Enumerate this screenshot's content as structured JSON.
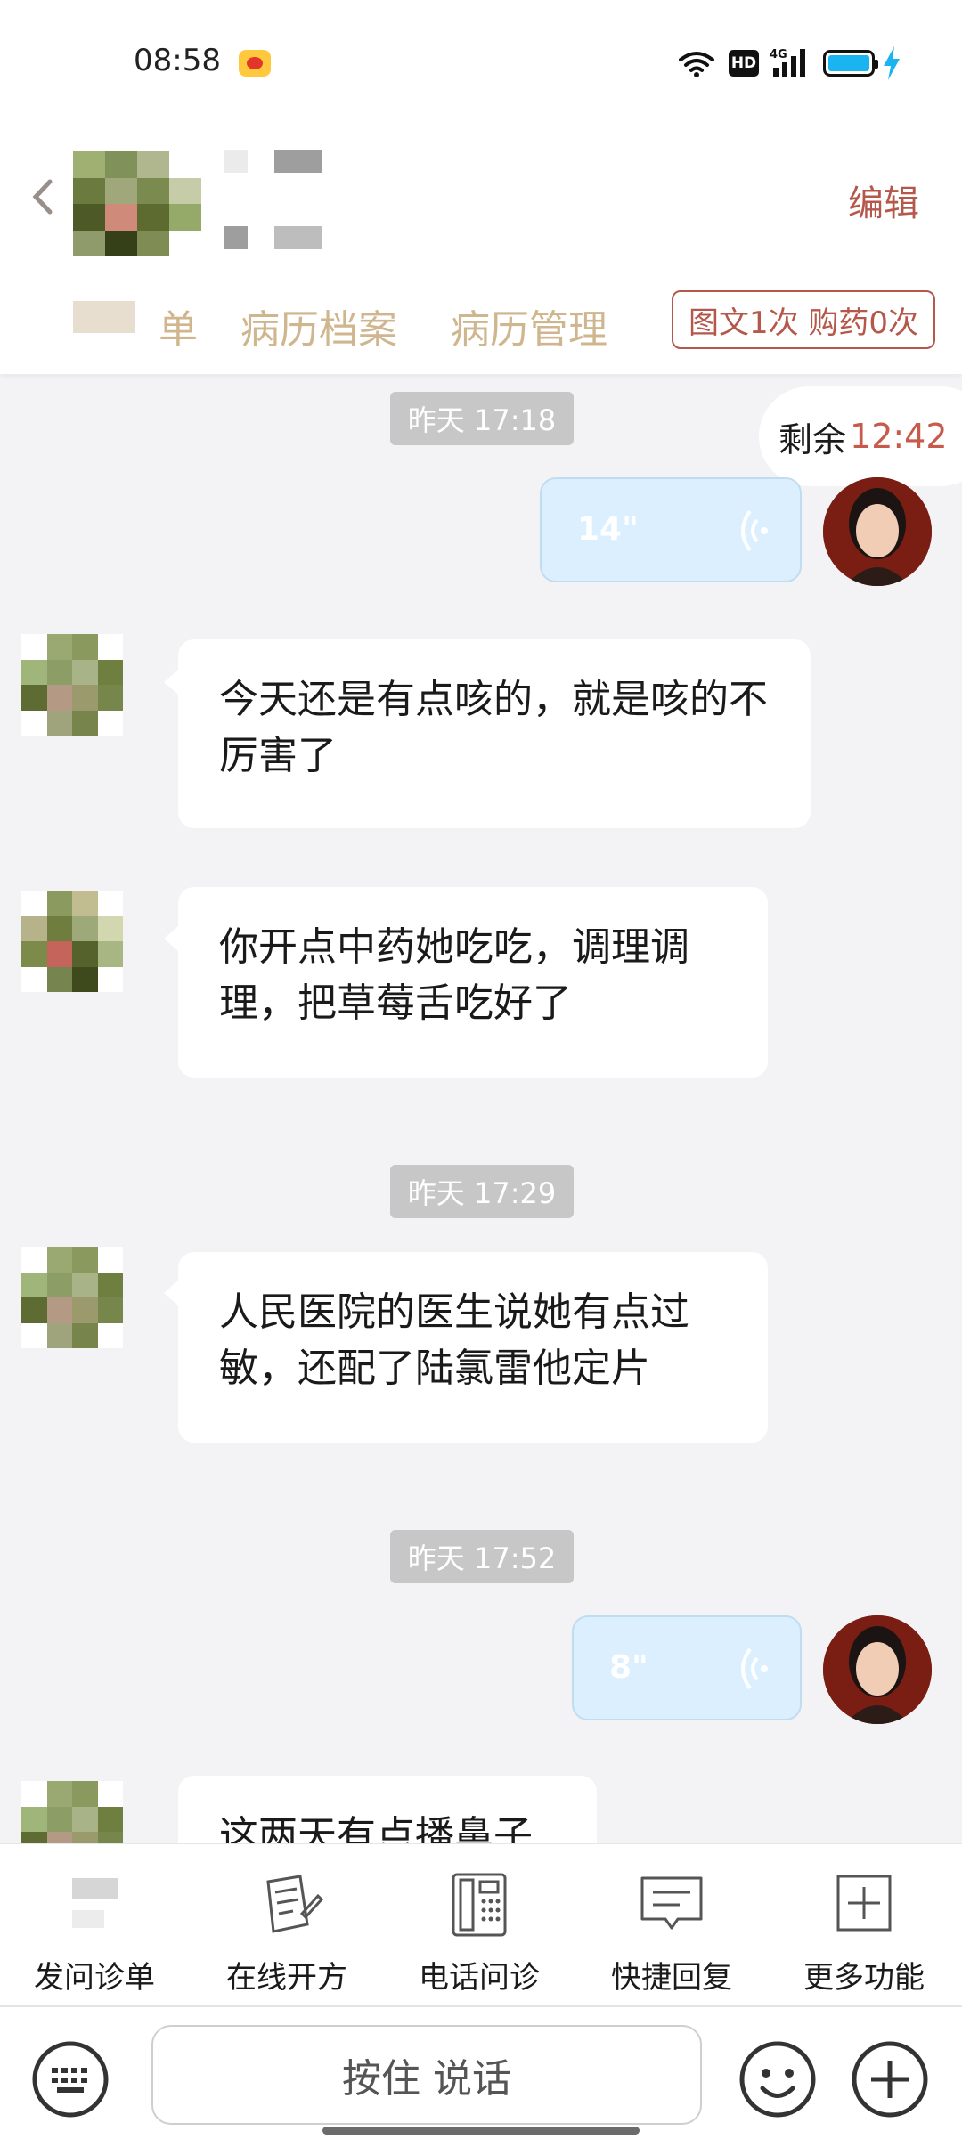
{
  "status_bar": {
    "time": "08:58",
    "network": "4G",
    "hd_label": "HD",
    "icons": [
      "weibo-icon",
      "wifi-icon",
      "signal-icon",
      "battery-icon",
      "charging-icon"
    ]
  },
  "header": {
    "edit_label": "编辑",
    "tabs": [
      "单",
      "病历档案",
      "病历管理"
    ],
    "quota_label": "图文1次 购药0次"
  },
  "remaining": {
    "label": "剩余",
    "time": "12:42"
  },
  "messages": [
    {
      "type": "timestamp",
      "text": "昨天 17:18"
    },
    {
      "type": "voice",
      "from": "doctor",
      "duration": "14\""
    },
    {
      "type": "text",
      "from": "patient",
      "text": "今天还是有点咳的，就是咳的不厉害了"
    },
    {
      "type": "text",
      "from": "patient",
      "text": "你开点中药她吃吃，调理调理，把草莓舌吃好了"
    },
    {
      "type": "timestamp",
      "text": "昨天 17:29"
    },
    {
      "type": "text",
      "from": "patient",
      "text": "人民医院的医生说她有点过敏，还配了陆氯雷他定片"
    },
    {
      "type": "timestamp",
      "text": "昨天 17:52"
    },
    {
      "type": "voice",
      "from": "doctor",
      "duration": "8\""
    },
    {
      "type": "text",
      "from": "patient",
      "text": "这两天有点播鼻子"
    }
  ],
  "toolbar": {
    "items": [
      {
        "label": "发问诊单",
        "icon": "questionnaire-icon"
      },
      {
        "label": "在线开方",
        "icon": "prescription-icon"
      },
      {
        "label": "电话问诊",
        "icon": "phone-icon"
      },
      {
        "label": "快捷回复",
        "icon": "quick-reply-icon"
      },
      {
        "label": "更多功能",
        "icon": "more-plus-icon"
      }
    ]
  },
  "input_bar": {
    "hold_to_talk": "按住 说话",
    "icons": [
      "keyboard-icon",
      "emoji-icon",
      "plus-icon"
    ]
  },
  "colors": {
    "accent": "#b5574a",
    "tab_text": "#cfb68f",
    "voice_bubble": "#dcefff",
    "chat_background": "#f3f3f6"
  }
}
